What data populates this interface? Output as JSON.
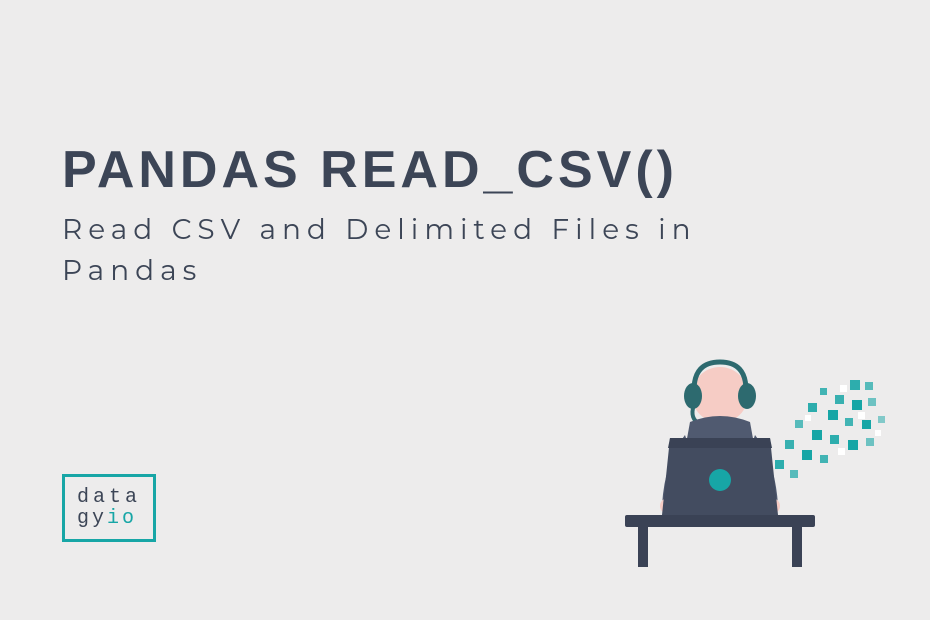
{
  "hero": {
    "title": "PANDAS READ_CSV()",
    "subtitle": "Read CSV and Delimited Files in Pandas"
  },
  "logo": {
    "line1": "data",
    "line2_plain": "gy",
    "line2_accent": "io"
  },
  "colors": {
    "accent": "#17a6a6",
    "bg": "#edecec",
    "text": "#3c4556"
  }
}
